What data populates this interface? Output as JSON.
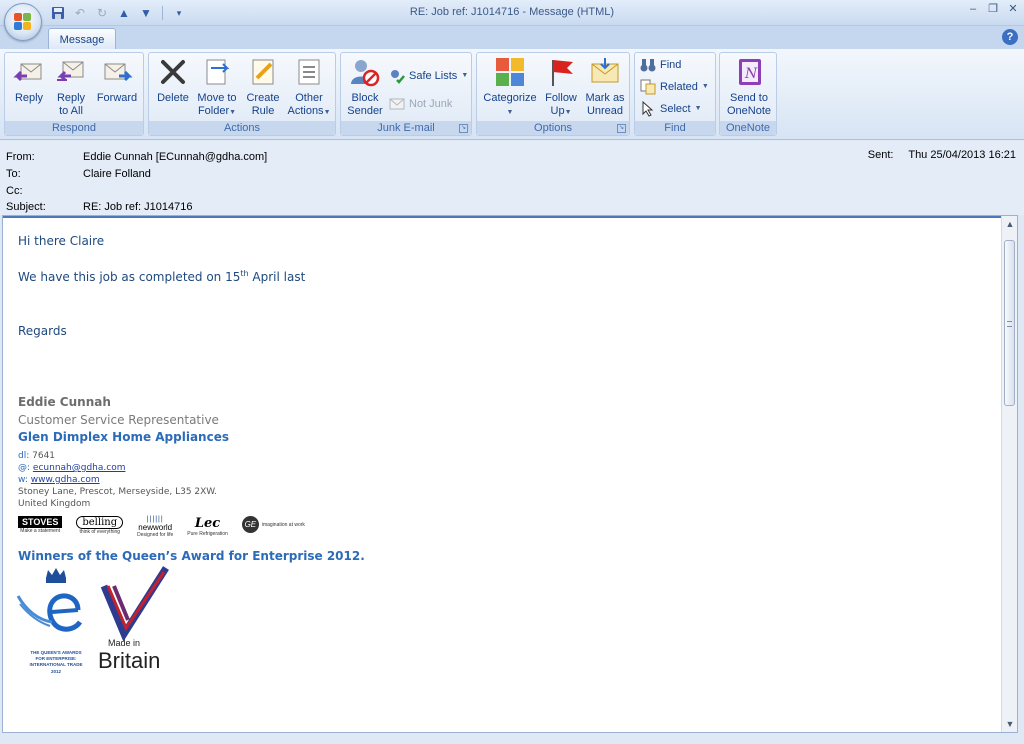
{
  "window": {
    "title": "RE: Job ref: J1014716 - Message (HTML)",
    "controls": {
      "minimize": "–",
      "restore": "❐",
      "close": "✕"
    }
  },
  "ribbon": {
    "tab": "Message",
    "help": "?",
    "groups": {
      "respond": {
        "label": "Respond",
        "reply": "Reply",
        "reply_all": "Reply\nto All",
        "forward": "Forward"
      },
      "actions": {
        "label": "Actions",
        "delete": "Delete",
        "move_to_folder": "Move to\nFolder",
        "create_rule": "Create\nRule",
        "other_actions": "Other\nActions"
      },
      "junk": {
        "label": "Junk E-mail",
        "block_sender": "Block\nSender",
        "safe_lists": "Safe Lists",
        "not_junk": "Not Junk"
      },
      "options": {
        "label": "Options",
        "categorize": "Categorize",
        "follow_up": "Follow\nUp",
        "mark_unread": "Mark as\nUnread"
      },
      "find": {
        "label": "Find",
        "find": "Find",
        "related": "Related",
        "select": "Select"
      },
      "onenote": {
        "label": "OneNote",
        "send_to_onenote": "Send to\nOneNote"
      }
    }
  },
  "header": {
    "from_label": "From:",
    "from_value": "Eddie Cunnah [ECunnah@gdha.com]",
    "to_label": "To:",
    "to_value": "Claire Folland",
    "cc_label": "Cc:",
    "cc_value": "",
    "subject_label": "Subject:",
    "subject_value": "RE: Job ref: J1014716",
    "sent_label": "Sent:",
    "sent_value": "Thu 25/04/2013 16:21"
  },
  "body": {
    "greeting": "Hi there Claire",
    "line1_pre": "We have this job as completed on 15",
    "line1_sup": "th",
    "line1_post": " April last",
    "regards": "Regards"
  },
  "signature": {
    "name": "Eddie Cunnah",
    "title": "Customer Service Representative",
    "company": "Glen Dimplex Home Appliances",
    "dl_key": "dl:",
    "dl_value": " 7641",
    "email_key": "@:",
    "email_value": "ecunnah@gdha.com",
    "web_key": "w:",
    "web_value": "www.gdha.com",
    "address": "Stoney Lane, Prescot, Merseyside, L35 2XW.",
    "country": "United Kingdom",
    "brands": [
      {
        "name": "STOVES",
        "tagline": "Make a statement"
      },
      {
        "name": "belling",
        "tagline": "think of everything"
      },
      {
        "name": "newworld",
        "tagline": "Designed for life"
      },
      {
        "name": "Lec",
        "tagline": "Pure Refrigeration"
      },
      {
        "name": "GE",
        "tagline": "imagination at work"
      }
    ],
    "award": "Winners of the Queen’s Award for Enterprise 2012.",
    "award_logo_text": "THE QUEEN'S AWARDS FOR ENTERPRISE: INTERNATIONAL TRADE 2012",
    "made_in": "Made in",
    "britain": "Britain"
  },
  "colors": {
    "ribbon_text": "#15428b",
    "body_text": "#1f497d",
    "signature_blue": "#2b6bb8"
  }
}
